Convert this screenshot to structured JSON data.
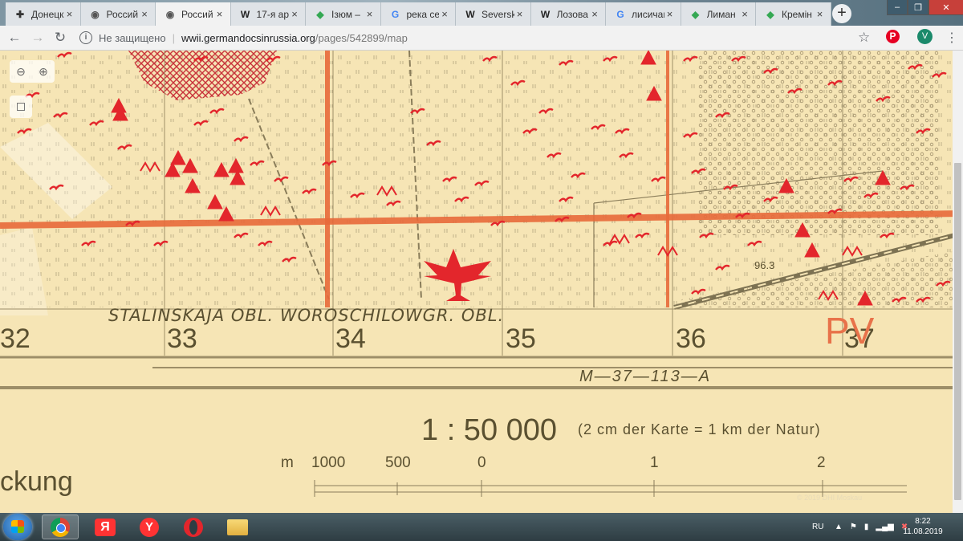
{
  "browser": {
    "tabs": [
      {
        "title": "Донецк",
        "icon": "cross-icon",
        "active": false
      },
      {
        "title": "Россий",
        "icon": "globe-icon",
        "active": false
      },
      {
        "title": "Россий",
        "icon": "globe-icon",
        "active": true
      },
      {
        "title": "17-я ар",
        "icon": "wikipedia-icon",
        "active": false
      },
      {
        "title": "Ізюм –",
        "icon": "maps-icon",
        "active": false
      },
      {
        "title": "река се",
        "icon": "google-icon",
        "active": false
      },
      {
        "title": "Seversk",
        "icon": "wikipedia-icon",
        "active": false
      },
      {
        "title": "Лозова",
        "icon": "wikipedia-icon",
        "active": false
      },
      {
        "title": "лисичан",
        "icon": "google-icon",
        "active": false
      },
      {
        "title": "Лиман",
        "icon": "maps-icon",
        "active": false
      },
      {
        "title": "Кремін",
        "icon": "maps-icon",
        "active": false
      }
    ],
    "tab_close_glyph": "×",
    "new_tab_glyph": "+",
    "window_controls": {
      "minimize": "–",
      "maximize": "❐",
      "close": "✕"
    },
    "address": {
      "security_label": "Не защищено",
      "host": "wwii.germandocsinrussia.org",
      "path": "/pages/542899/map"
    },
    "avatar_letter": "V",
    "pinterest_letter": "P"
  },
  "map": {
    "zoom_out": "⊖",
    "zoom_in": "⊕",
    "border_label": "STALINSKAJA OBL. WOROSCHILOWGR. OBL.",
    "grid_numbers": [
      "32",
      "33",
      "34",
      "35",
      "36",
      "37"
    ],
    "sheet_code": "M—37—113—A",
    "scale": "1 : 50 000",
    "scale_note": "(2 cm der Karte = 1 km der Natur)",
    "scale_ticks": [
      "m",
      "1000",
      "500",
      "0",
      "1",
      "2"
    ],
    "elevation": "96.3",
    "pv_label": "PV",
    "legend_partial": "ckung",
    "copyright": "© 2019 DHI Moskau"
  },
  "taskbar": {
    "apps": [
      "explorer-icon",
      "chrome-icon",
      "yandex-browser-icon",
      "yandex-icon",
      "opera-icon",
      "folder-icon"
    ],
    "lang": "RU",
    "time": "8:22",
    "date": "11.08.2019"
  },
  "colors": {
    "map_bg": "#f6e5b5",
    "symbol_red": "#e3262c",
    "road_orange": "#e86a3a"
  }
}
